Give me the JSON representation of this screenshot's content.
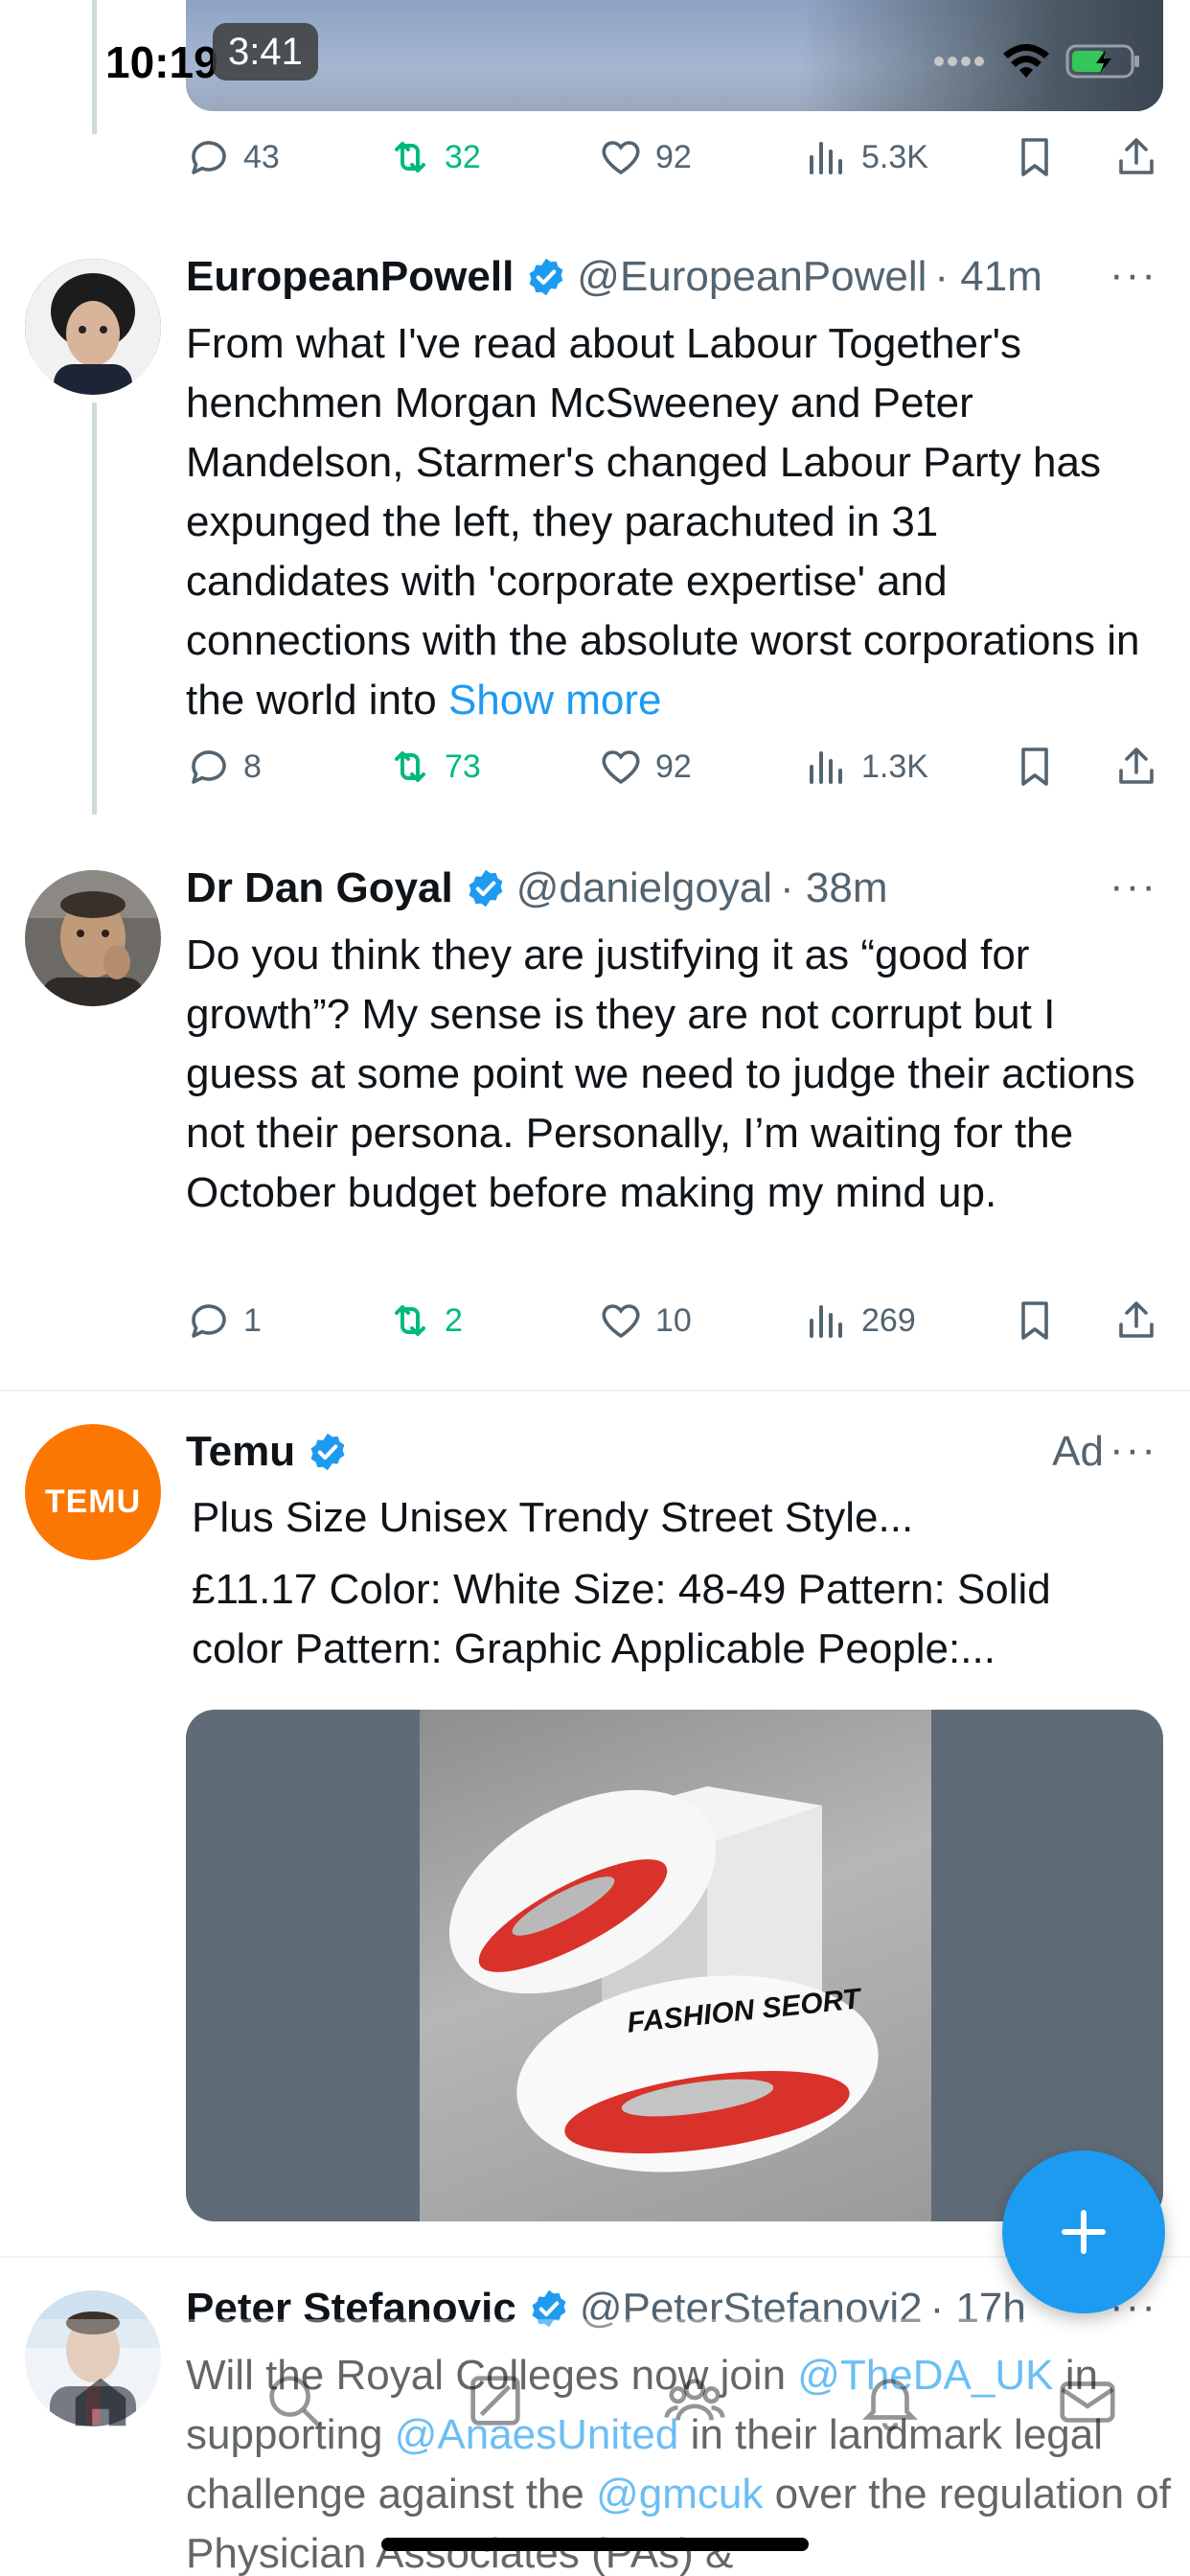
{
  "status_bar": {
    "time": "10:19",
    "timer": "3:41"
  },
  "tweets": [
    {
      "stats": {
        "replies": "43",
        "retweets": "32",
        "likes": "92",
        "views": "5.3K"
      }
    },
    {
      "name": "EuropeanPowell",
      "handle": "@EuropeanPowell",
      "time": "· 41m",
      "text": "From what I've read about Labour Together's henchmen Morgan McSweeney and Peter Mandelson, Starmer's changed Labour Party has expunged the left, they parachuted in 31 candidates with 'corporate expertise' and connections with the absolute worst corporations in the world into",
      "show_more": "Show more",
      "stats": {
        "replies": "8",
        "retweets": "73",
        "likes": "92",
        "views": "1.3K"
      }
    },
    {
      "name": "Dr Dan Goyal",
      "handle": "@danielgoyal",
      "time": "· 38m",
      "text": "Do you think they are justifying it as “good for growth”?  My sense is they are not corrupt but I guess at some point we need to judge their actions not their persona. Personally, I’m waiting for the October budget before making my mind up.",
      "stats": {
        "replies": "1",
        "retweets": "2",
        "likes": "10",
        "views": "269"
      }
    }
  ],
  "ad": {
    "name": "Temu",
    "logo_text": "TEMU",
    "badge": "Ad",
    "title": "Plus Size Unisex Trendy Street Style...",
    "description": "£11.17 Color: White Size: 48-49 Pattern: Solid color Pattern: Graphic Applicable People:...",
    "product_print": "FASHION SEORT"
  },
  "bottom_tweet": {
    "name": "Peter Stefanovic",
    "handle": "@PeterStefanovi2",
    "time": "· 17h",
    "text_1": "Will the Royal Colleges now join",
    "mention_1": "@TheDA_UK",
    "text_2": "in supporting",
    "mention_2": "@AnaesUnited",
    "text_3": "in their landmark legal challenge against the",
    "mention_3": "@gmcuk",
    "text_4": "over the regulation of Physician Associates (PAs) &"
  },
  "icons": {
    "reply": "reply-icon",
    "retweet": "retweet-icon",
    "like": "heart-icon",
    "views": "views-icon",
    "bookmark": "bookmark-icon",
    "share": "share-icon",
    "compose": "plus-icon",
    "nav": [
      "home-icon",
      "search-icon",
      "grok-icon",
      "communities-icon",
      "notifications-icon",
      "messages-icon"
    ]
  },
  "colors": {
    "accent": "#1d9bf0",
    "retweet": "#00ba7c",
    "secondary_text": "#536471",
    "temu": "#fb7701"
  }
}
